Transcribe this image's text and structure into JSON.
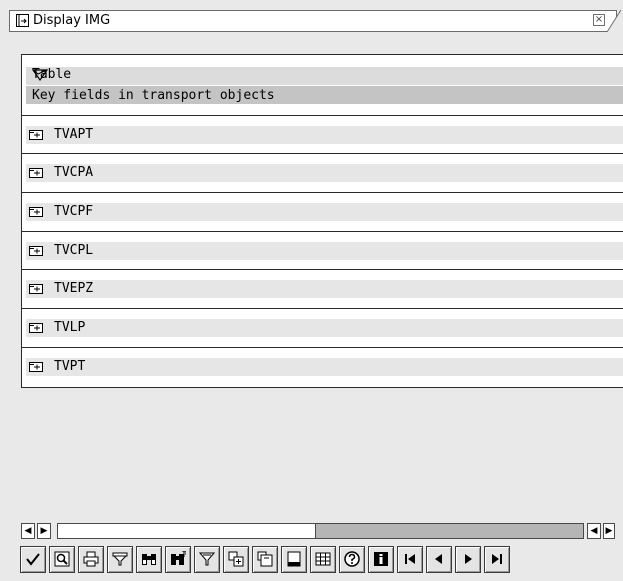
{
  "window": {
    "title": "Display IMG",
    "close_symbol": "×"
  },
  "tree": {
    "header": {
      "icon": "tree-collapse-icon",
      "title": "Table",
      "description": "Key fields in transport objects"
    },
    "nodes": [
      {
        "label": "TVAPT",
        "icon": "expand-node-icon"
      },
      {
        "label": "TVCPA",
        "icon": "expand-node-icon"
      },
      {
        "label": "TVCPF",
        "icon": "expand-node-icon"
      },
      {
        "label": "TVCPL",
        "icon": "expand-node-icon"
      },
      {
        "label": "TVEPZ",
        "icon": "expand-node-icon"
      },
      {
        "label": "TVLP",
        "icon": "expand-node-icon"
      },
      {
        "label": "TVPT",
        "icon": "expand-node-icon"
      }
    ]
  },
  "hscroll": {
    "left_arrow": "◀",
    "right_arrow": "▶",
    "thumb_fraction": 0.49
  },
  "toolbar": {
    "buttons": [
      "check-icon",
      "find-icon",
      "print-icon",
      "filter-icon",
      "find-binoculars-icon",
      "find-next-icon",
      "set-filter-icon",
      "expand-subtree-icon",
      "collapse-subtree-icon",
      "save-icon",
      "table-icon",
      "help-icon",
      "info-icon",
      "first-page-icon",
      "previous-page-icon",
      "next-page-icon",
      "last-page-icon"
    ]
  },
  "colors": {
    "background": "#e9e9e9",
    "panel": "#ffffff",
    "header_band": "#dcdcdc",
    "header_band_dark": "#c4c4c4",
    "row_band": "#e6e6e6",
    "border": "#2b2b2b"
  }
}
